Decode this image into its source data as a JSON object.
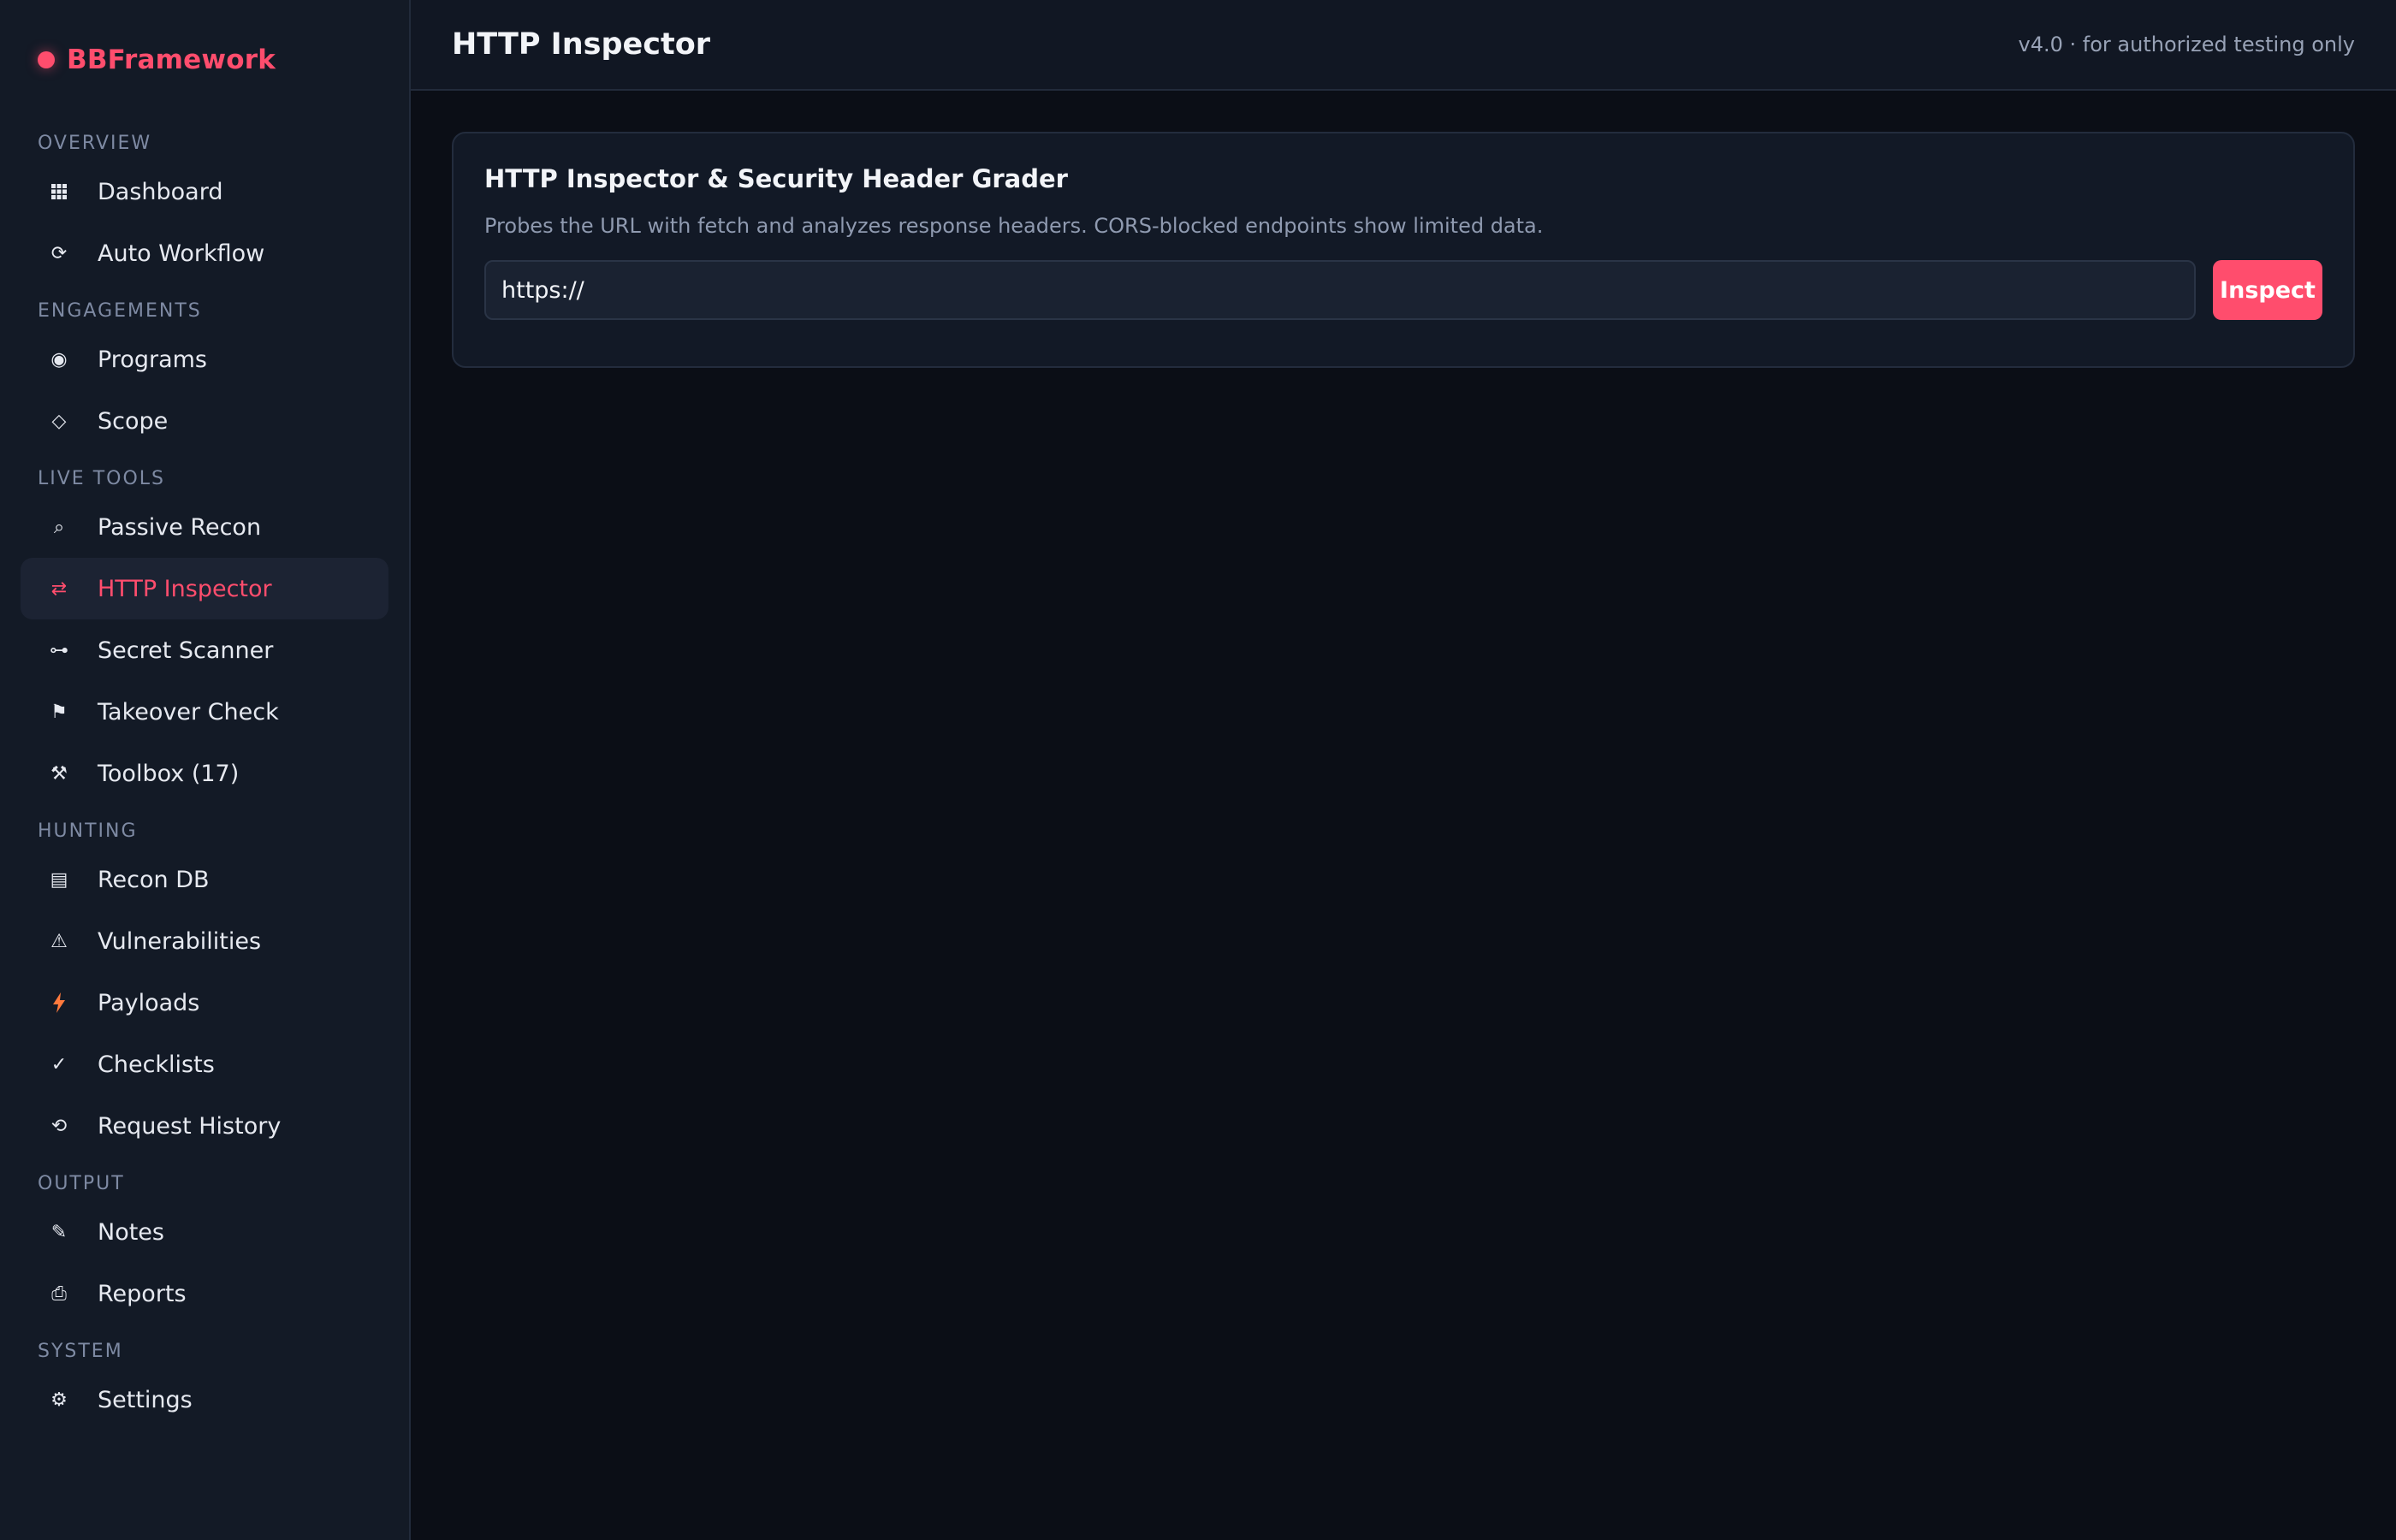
{
  "brand": {
    "name": "BBFramework",
    "accent": "#ff4d6d"
  },
  "sidebar": {
    "sections": [
      {
        "label": "OVERVIEW",
        "items": [
          {
            "label": "Dashboard",
            "icon": "grid-icon"
          },
          {
            "label": "Auto Workflow",
            "icon": "refresh-icon"
          }
        ]
      },
      {
        "label": "ENGAGEMENTS",
        "items": [
          {
            "label": "Programs",
            "icon": "target-icon"
          },
          {
            "label": "Scope",
            "icon": "diamond-icon"
          }
        ]
      },
      {
        "label": "LIVE TOOLS",
        "items": [
          {
            "label": "Passive Recon",
            "icon": "search-icon"
          },
          {
            "label": "HTTP Inspector",
            "icon": "swap-arrows-icon",
            "active": true
          },
          {
            "label": "Secret Scanner",
            "icon": "key-icon"
          },
          {
            "label": "Takeover Check",
            "icon": "flag-icon"
          },
          {
            "label": "Toolbox (17)",
            "icon": "tools-icon"
          }
        ]
      },
      {
        "label": "HUNTING",
        "items": [
          {
            "label": "Recon DB",
            "icon": "database-icon"
          },
          {
            "label": "Vulnerabilities",
            "icon": "warning-icon"
          },
          {
            "label": "Payloads",
            "icon": "bolt-icon"
          },
          {
            "label": "Checklists",
            "icon": "check-icon"
          },
          {
            "label": "Request History",
            "icon": "history-icon"
          }
        ]
      },
      {
        "label": "OUTPUT",
        "items": [
          {
            "label": "Notes",
            "icon": "pencil-icon"
          },
          {
            "label": "Reports",
            "icon": "report-icon"
          }
        ]
      },
      {
        "label": "SYSTEM",
        "items": [
          {
            "label": "Settings",
            "icon": "gear-icon"
          }
        ]
      }
    ]
  },
  "header": {
    "title": "HTTP Inspector",
    "version": "v4.0 · for authorized testing only"
  },
  "inspector": {
    "title": "HTTP Inspector & Security Header Grader",
    "description": "Probes the URL with fetch and analyzes response headers. CORS-blocked endpoints show limited data.",
    "url_value": "https://",
    "button_label": "Inspect"
  }
}
